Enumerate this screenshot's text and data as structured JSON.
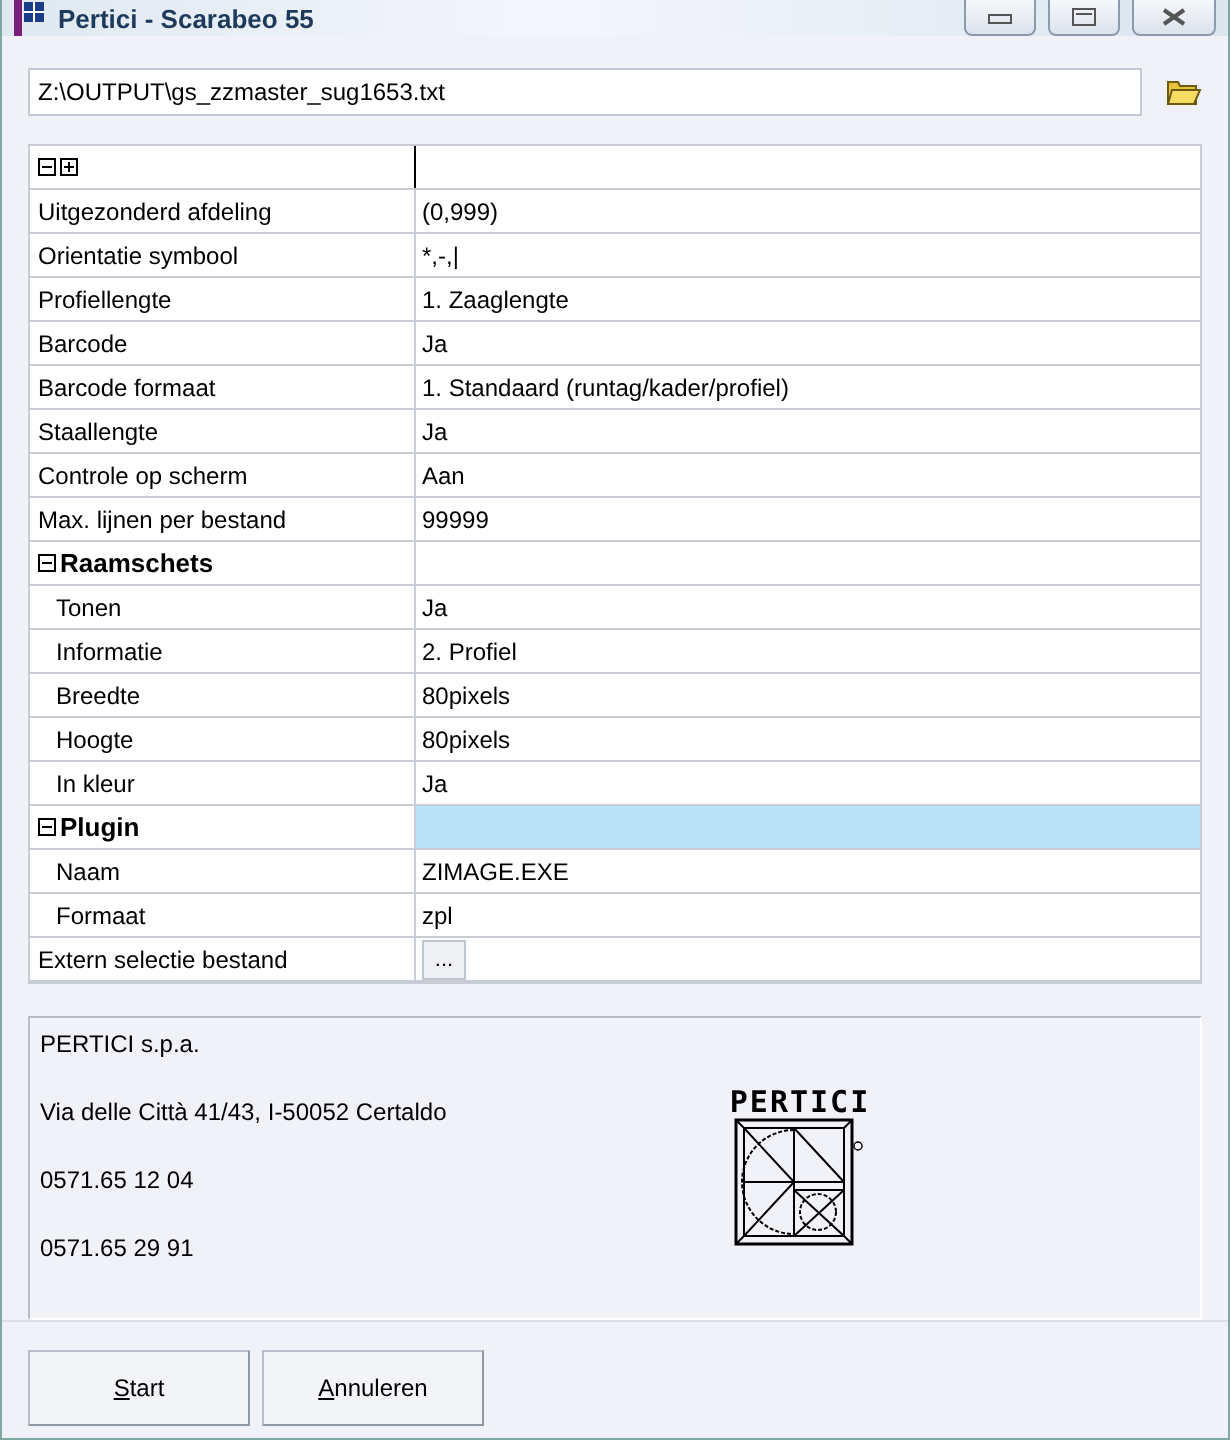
{
  "window": {
    "title": "Pertici - Scarabeo 55"
  },
  "path_field": {
    "value": "Z:\\OUTPUT\\gs_zzmaster_sug1653.txt"
  },
  "properties": [
    {
      "kind": "item",
      "label": "Uitgezonderd afdeling",
      "value": "(0,999)",
      "selected": false
    },
    {
      "kind": "item",
      "label": "Orientatie symbool",
      "value": "*,-,|",
      "selected": false
    },
    {
      "kind": "item",
      "label": "Profiellengte",
      "value": "1. Zaaglengte",
      "selected": false
    },
    {
      "kind": "item",
      "label": "Barcode",
      "value": "Ja",
      "selected": false
    },
    {
      "kind": "item",
      "label": "Barcode formaat",
      "value": "1. Standaard (runtag/kader/profiel)",
      "selected": false
    },
    {
      "kind": "item",
      "label": "Staallengte",
      "value": "Ja",
      "selected": false
    },
    {
      "kind": "item",
      "label": "Controle op scherm",
      "value": "Aan",
      "selected": false
    },
    {
      "kind": "item",
      "label": "Max. lijnen per bestand",
      "value": "99999",
      "selected": false
    },
    {
      "kind": "group",
      "label": "Raamschets",
      "expanded": true,
      "selected": false,
      "children": [
        {
          "label": "Tonen",
          "value": "Ja"
        },
        {
          "label": "Informatie",
          "value": "2. Profiel"
        },
        {
          "label": "Breedte",
          "value": "80pixels"
        },
        {
          "label": "Hoogte",
          "value": "80pixels"
        },
        {
          "label": "In kleur",
          "value": "Ja"
        }
      ]
    },
    {
      "kind": "group",
      "label": "Plugin",
      "expanded": true,
      "selected": true,
      "children": [
        {
          "label": "Naam",
          "value": "ZIMAGE.EXE"
        },
        {
          "label": "Formaat",
          "value": "zpl"
        }
      ]
    },
    {
      "kind": "browse",
      "label": "Extern selectie bestand",
      "button": "...",
      "selected": false
    }
  ],
  "info": {
    "lines": [
      "PERTICI s.p.a.",
      "Via delle Città 41/43, I-50052 Certaldo",
      "0571.65 12 04",
      "0571.65 29 91"
    ],
    "logo_text": "PERTICI"
  },
  "buttons": [
    "Start",
    "Annuleren"
  ]
}
